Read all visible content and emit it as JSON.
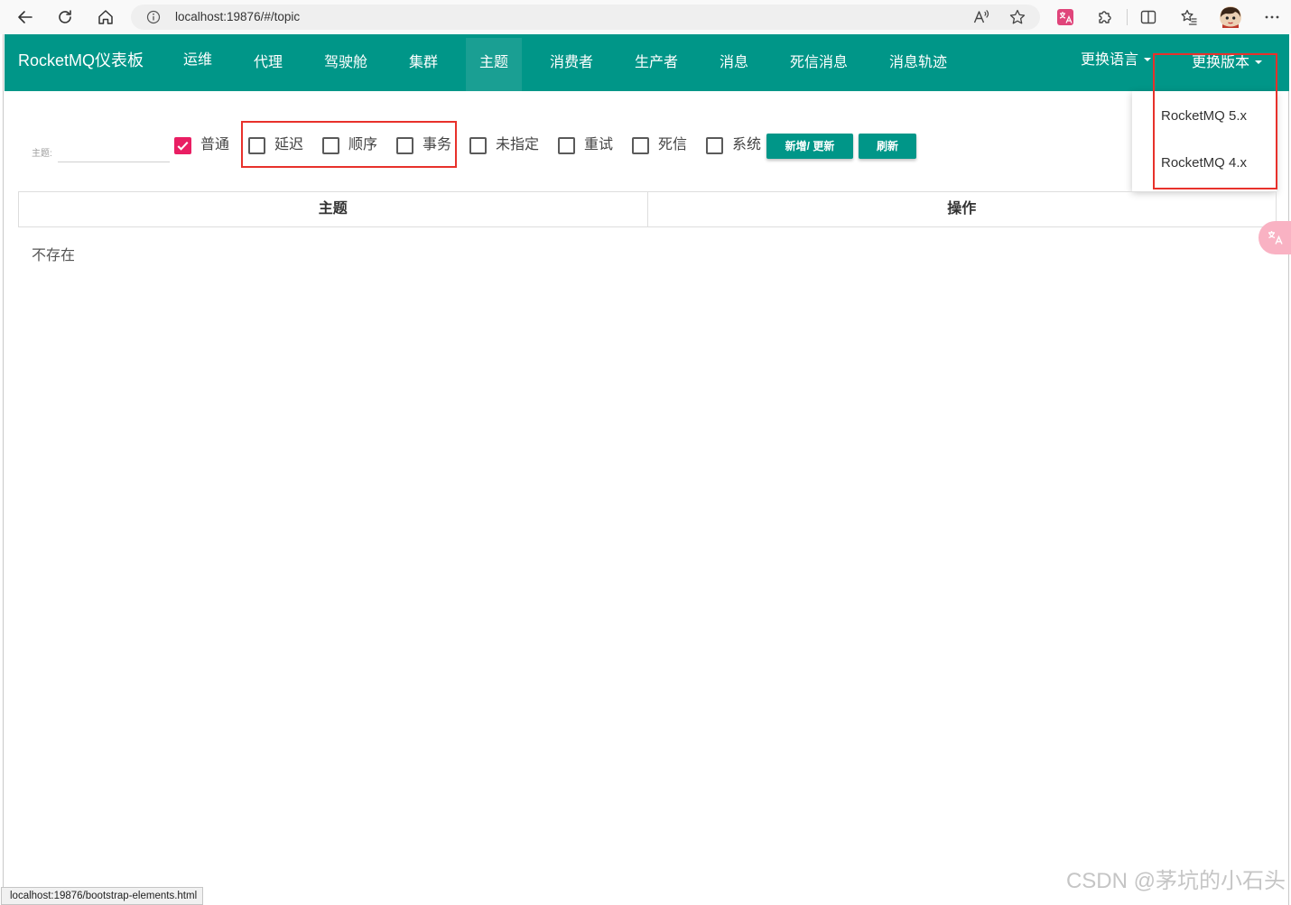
{
  "browser": {
    "url": "localhost:19876/#/topic",
    "toolbar_icons": [
      "back-arrow-icon",
      "refresh-icon",
      "home-icon",
      "site-info-icon",
      "read-aloud-icon",
      "add-favorite-star-icon",
      "translate-extension-icon",
      "extensions-puzzle-icon",
      "split-screen-icon",
      "favorites-icon",
      "profile-avatar",
      "more-menu-icon"
    ]
  },
  "nav": {
    "brand": "RocketMQ仪表板",
    "items": [
      {
        "label": "运维",
        "active": false
      },
      {
        "label": "代理",
        "active": false
      },
      {
        "label": "驾驶舱",
        "active": false
      },
      {
        "label": "集群",
        "active": false
      },
      {
        "label": "主题",
        "active": true
      },
      {
        "label": "消费者",
        "active": false
      },
      {
        "label": "生产者",
        "active": false
      },
      {
        "label": "消息",
        "active": false
      },
      {
        "label": "死信消息",
        "active": false
      },
      {
        "label": "消息轨迹",
        "active": false
      }
    ],
    "language_dropdown": "更换语言",
    "version_dropdown": {
      "label": "更换版本",
      "open": true,
      "options": [
        "RocketMQ 5.x",
        "RocketMQ 4.x"
      ]
    }
  },
  "filter": {
    "topic_label": "主题:",
    "topic_value": "",
    "topic_types": [
      {
        "label": "普通",
        "checked": true
      },
      {
        "label": "延迟",
        "checked": false
      },
      {
        "label": "顺序",
        "checked": false
      },
      {
        "label": "事务",
        "checked": false
      },
      {
        "label": "未指定",
        "checked": false
      },
      {
        "label": "重试",
        "checked": false
      },
      {
        "label": "死信",
        "checked": false
      },
      {
        "label": "系统",
        "checked": false
      }
    ],
    "add_update_button": "新增/ 更新",
    "refresh_button": "刷新"
  },
  "topic_table": {
    "headers": [
      "主题",
      "操作"
    ],
    "rows": [],
    "empty_message": "不存在"
  },
  "status_bar_link": "localhost:19876/bootstrap-elements.html",
  "watermark": "CSDN @茅坑的小石头",
  "colors": {
    "navbar": "#009688",
    "navbar_active": "#1a9f93",
    "checkbox_checked": "#e91e63",
    "button": "#009688",
    "annotation_red": "#e8312b"
  }
}
